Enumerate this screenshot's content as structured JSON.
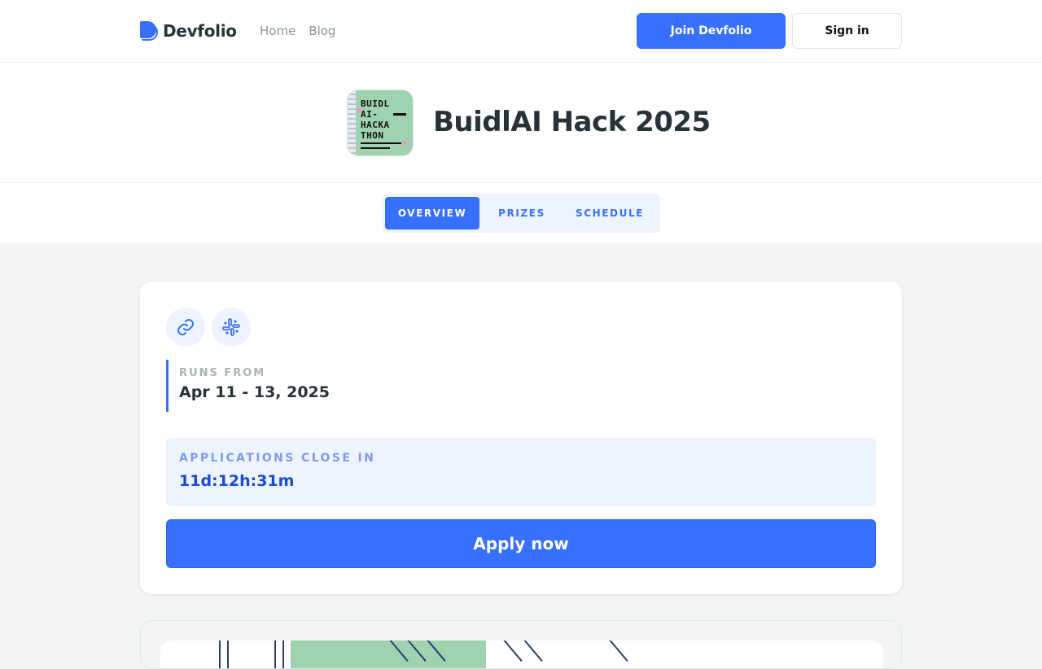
{
  "header": {
    "brand": "Devfolio",
    "nav": [
      "Home",
      "Blog"
    ],
    "join_label": "Join Devfolio",
    "signin_label": "Sign in"
  },
  "hackathon": {
    "title": "BuidlAI Hack 2025",
    "logo_lines": [
      "BUIDL",
      "AI-",
      "HACKA",
      "THON"
    ]
  },
  "tabs": [
    {
      "label": "OVERVIEW",
      "active": true
    },
    {
      "label": "PRIZES",
      "active": false
    },
    {
      "label": "SCHEDULE",
      "active": false
    }
  ],
  "overview": {
    "icons": [
      "link-icon",
      "slack-icon"
    ],
    "runs_label": "RUNS FROM",
    "runs_value": "Apr 11 - 13, 2025",
    "close_label": "APPLICATIONS CLOSE IN",
    "close_value": "11d:12h:31m",
    "apply_label": "Apply now"
  },
  "colors": {
    "accent": "#3770ff",
    "accent_light": "#eef4ff",
    "countdown": "#1a4bd6",
    "text": "#273339"
  }
}
